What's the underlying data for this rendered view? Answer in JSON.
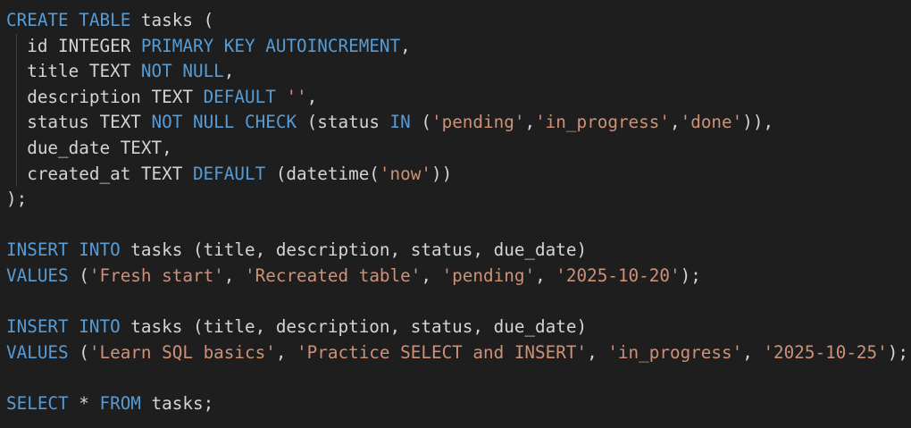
{
  "colors": {
    "background": "#1e1e1e",
    "keyword": "#569cd6",
    "string": "#ce9178",
    "identifier": "#d4d4d4",
    "indent_guide": "#404040"
  },
  "lines": [
    [
      [
        "kw",
        "CREATE"
      ],
      [
        "p",
        " "
      ],
      [
        "kw",
        "TABLE"
      ],
      [
        "id",
        " tasks ("
      ]
    ],
    [
      [
        "id",
        "  id INTEGER "
      ],
      [
        "kw",
        "PRIMARY"
      ],
      [
        "p",
        " "
      ],
      [
        "kw",
        "KEY"
      ],
      [
        "p",
        " "
      ],
      [
        "kw",
        "AUTOINCREMENT"
      ],
      [
        "p",
        ","
      ]
    ],
    [
      [
        "id",
        "  title TEXT "
      ],
      [
        "kw",
        "NOT"
      ],
      [
        "p",
        " "
      ],
      [
        "kw",
        "NULL"
      ],
      [
        "p",
        ","
      ]
    ],
    [
      [
        "id",
        "  description TEXT "
      ],
      [
        "kw",
        "DEFAULT"
      ],
      [
        "p",
        " "
      ],
      [
        "str",
        "''"
      ],
      [
        "p",
        ","
      ]
    ],
    [
      [
        "id",
        "  status TEXT "
      ],
      [
        "kw",
        "NOT"
      ],
      [
        "p",
        " "
      ],
      [
        "kw",
        "NULL"
      ],
      [
        "p",
        " "
      ],
      [
        "kw",
        "CHECK"
      ],
      [
        "id",
        " (status "
      ],
      [
        "kw",
        "IN"
      ],
      [
        "p",
        " ("
      ],
      [
        "str",
        "'pending'"
      ],
      [
        "p",
        ","
      ],
      [
        "str",
        "'in_progress'"
      ],
      [
        "p",
        ","
      ],
      [
        "str",
        "'done'"
      ],
      [
        "p",
        ")),"
      ]
    ],
    [
      [
        "id",
        "  due_date TEXT,"
      ]
    ],
    [
      [
        "id",
        "  created_at TEXT "
      ],
      [
        "kw",
        "DEFAULT"
      ],
      [
        "id",
        " (datetime("
      ],
      [
        "str",
        "'now'"
      ],
      [
        "p",
        "))"
      ]
    ],
    [
      [
        "p",
        ");"
      ]
    ],
    [],
    [
      [
        "kw",
        "INSERT"
      ],
      [
        "p",
        " "
      ],
      [
        "kw",
        "INTO"
      ],
      [
        "id",
        " tasks (title, description, status, due_date)"
      ]
    ],
    [
      [
        "kw",
        "VALUES"
      ],
      [
        "p",
        " ("
      ],
      [
        "str",
        "'Fresh start'"
      ],
      [
        "p",
        ", "
      ],
      [
        "str",
        "'Recreated table'"
      ],
      [
        "p",
        ", "
      ],
      [
        "str",
        "'pending'"
      ],
      [
        "p",
        ", "
      ],
      [
        "str",
        "'2025-10-20'"
      ],
      [
        "p",
        ");"
      ]
    ],
    [],
    [
      [
        "kw",
        "INSERT"
      ],
      [
        "p",
        " "
      ],
      [
        "kw",
        "INTO"
      ],
      [
        "id",
        " tasks (title, description, status, due_date)"
      ]
    ],
    [
      [
        "kw",
        "VALUES"
      ],
      [
        "p",
        " ("
      ],
      [
        "str",
        "'Learn SQL basics'"
      ],
      [
        "p",
        ", "
      ],
      [
        "str",
        "'Practice SELECT and INSERT'"
      ],
      [
        "p",
        ", "
      ],
      [
        "str",
        "'in_progress'"
      ],
      [
        "p",
        ", "
      ],
      [
        "str",
        "'2025-10-25'"
      ],
      [
        "p",
        ");"
      ]
    ],
    [],
    [
      [
        "kw",
        "SELECT"
      ],
      [
        "p",
        " * "
      ],
      [
        "kw",
        "FROM"
      ],
      [
        "id",
        " tasks;"
      ]
    ]
  ]
}
